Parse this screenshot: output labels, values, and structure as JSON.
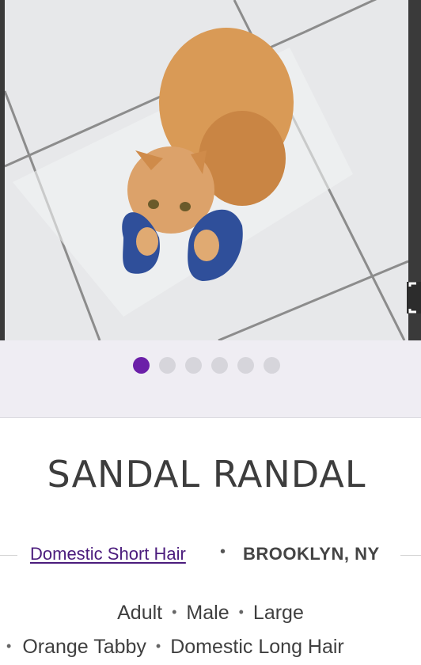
{
  "photo": {
    "alt_icon": "cat-photo"
  },
  "carousel": {
    "count": 6,
    "active_index": 0,
    "expand_icon": "expand-icon"
  },
  "pet": {
    "name": "SANDAL RANDAL",
    "breed": "Domestic Short Hair",
    "location": "BROOKLYN, NY",
    "age": "Adult",
    "sex": "Male",
    "size": "Large",
    "color": "Orange Tabby",
    "coat_breed": "Domestic Long Hair"
  },
  "colors": {
    "accent": "#6b1fa8",
    "link": "#4b1c7d"
  }
}
